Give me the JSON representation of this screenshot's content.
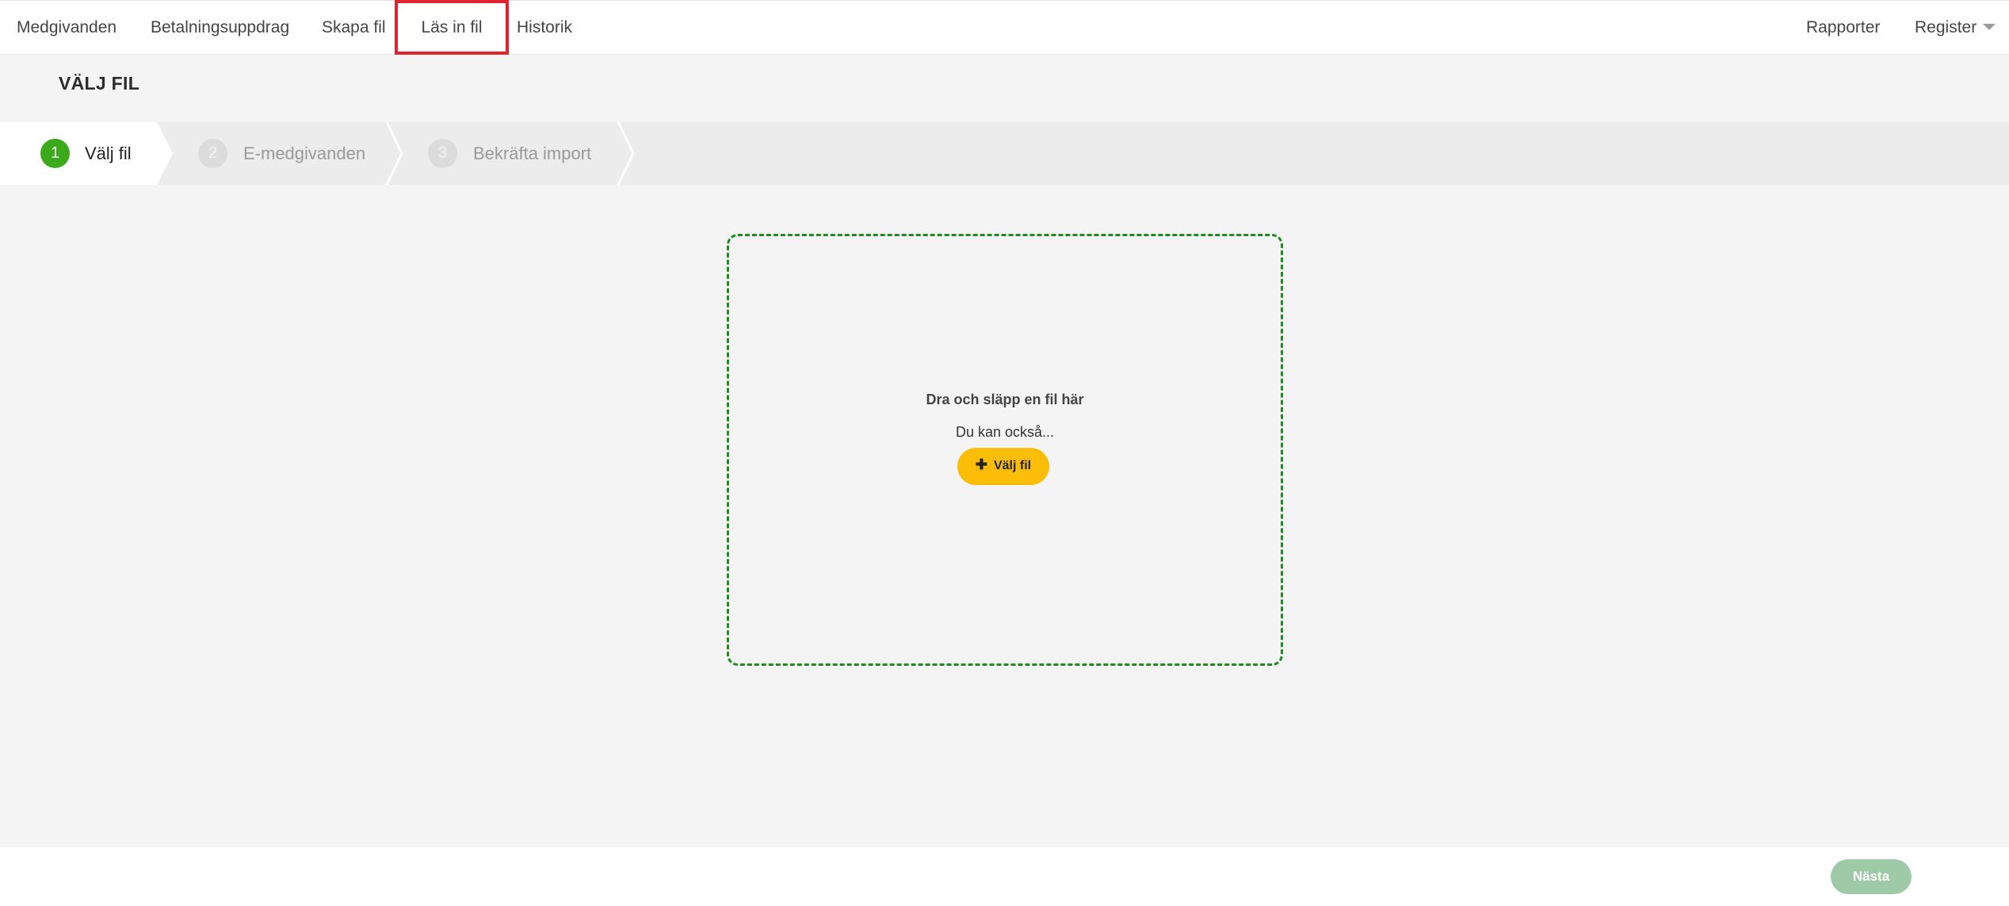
{
  "nav": {
    "left_items": [
      {
        "label": "Medgivanden"
      },
      {
        "label": "Betalningsuppdrag"
      },
      {
        "label": "Skapa fil"
      },
      {
        "label": "Läs in fil"
      },
      {
        "label": "Historik"
      }
    ],
    "active_item": "Läs in fil",
    "right_items": [
      {
        "label": "Rapporter"
      },
      {
        "label": "Register"
      }
    ]
  },
  "page": {
    "title": "VÄLJ FIL"
  },
  "stepper": {
    "steps": [
      {
        "number": "1",
        "label": "Välj fil",
        "state": "active"
      },
      {
        "number": "2",
        "label": "E-medgivanden",
        "state": "inactive"
      },
      {
        "number": "3",
        "label": "Bekräfta import",
        "state": "inactive"
      }
    ]
  },
  "dropzone": {
    "title": "Dra och släpp en fil här",
    "subtitle": "Du kan också...",
    "button_icon": "plus-icon",
    "button_label": "Välj fil"
  },
  "footer": {
    "next_label": "Nästa"
  },
  "colors": {
    "active_step": "#3aaa1a",
    "dropzone_border": "#1f8a1f",
    "choose_button": "#fbbd08",
    "next_button": "#9fcaa8",
    "active_nav_highlight": "#e0242f"
  }
}
